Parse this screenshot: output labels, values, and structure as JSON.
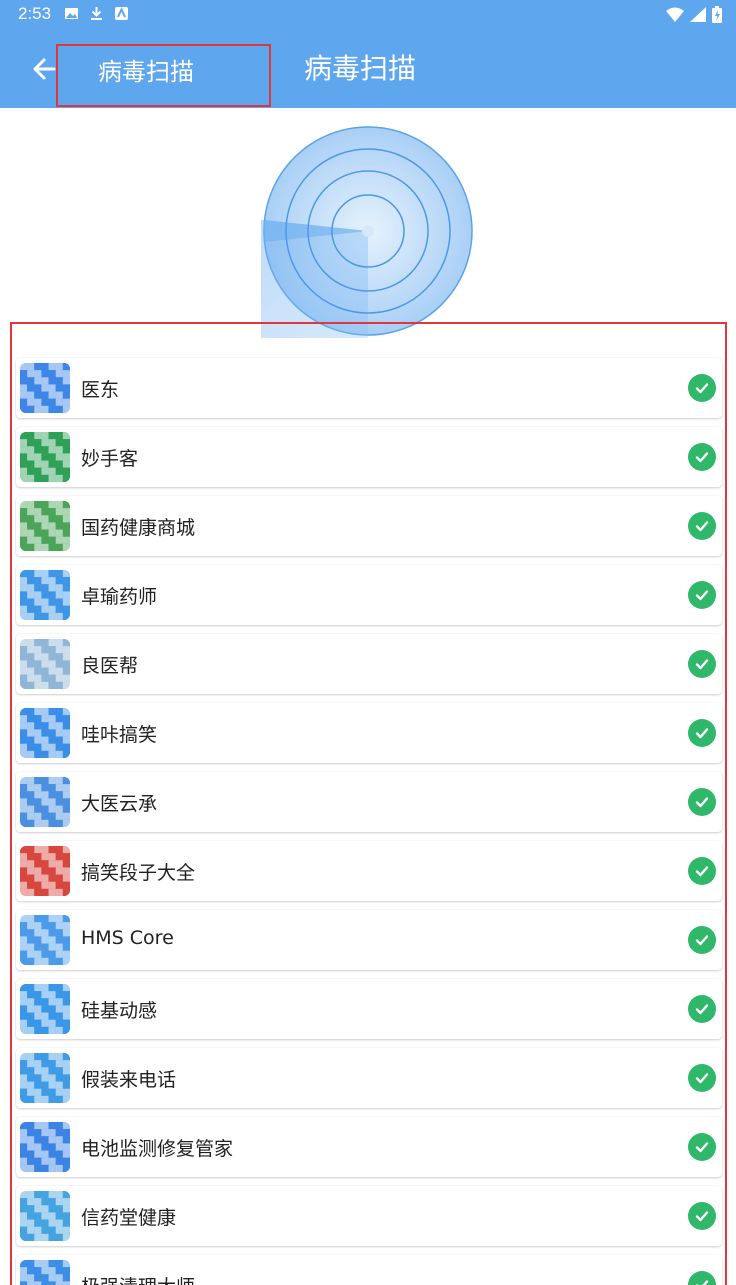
{
  "status_bar": {
    "time": "2:53"
  },
  "app_bar": {
    "left_title": "病毒扫描",
    "title": "病毒扫描"
  },
  "apps": [
    {
      "name": "医东",
      "color": "#3d86e8"
    },
    {
      "name": "妙手客",
      "color": "#2fa058"
    },
    {
      "name": "国药健康商城",
      "color": "#4aa45a"
    },
    {
      "name": "卓瑜药师",
      "color": "#3f95e6"
    },
    {
      "name": "良医帮",
      "color": "#8fb6d6"
    },
    {
      "name": "哇咔搞笑",
      "color": "#3a8ee8"
    },
    {
      "name": "大医云承",
      "color": "#4a8fe0"
    },
    {
      "name": "搞笑段子大全",
      "color": "#d8473f"
    },
    {
      "name": "HMS Core",
      "color": "#4c9bea"
    },
    {
      "name": "硅基动感",
      "color": "#3a97e8"
    },
    {
      "name": "假装来电话",
      "color": "#3f9be6"
    },
    {
      "name": "电池监测修复管家",
      "color": "#3b84e6"
    },
    {
      "name": "信药堂健康",
      "color": "#45a3e0"
    },
    {
      "name": "极强清理大师",
      "color": "#3d8ee6"
    }
  ],
  "colors": {
    "accent": "#5ea6ee",
    "check": "#2fb76a",
    "highlight": "#e0363d"
  }
}
